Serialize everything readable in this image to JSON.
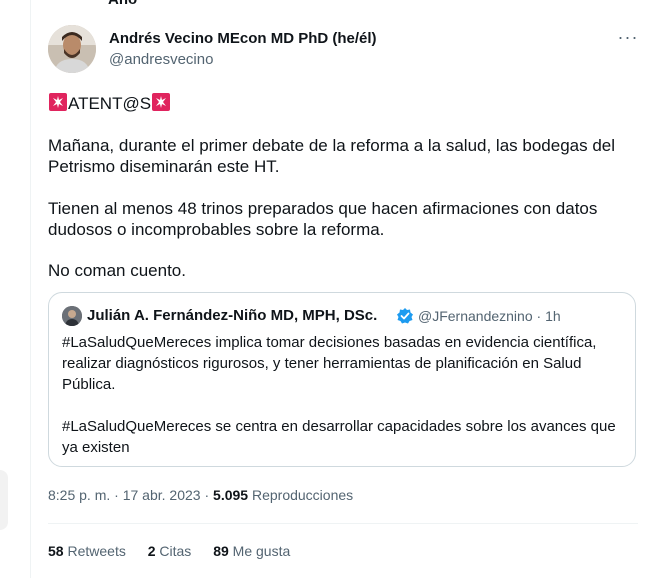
{
  "header": {
    "partial_top_text": "Ano"
  },
  "tweet": {
    "author_name": "Andrés Vecino MEcon MD PhD (he/él)",
    "author_handle": "@andresvecino",
    "more_label": "···",
    "alert_text": "ATENT@S",
    "paragraph_1": "Mañana, durante el primer debate de la reforma a la salud, las bodegas del Petrismo diseminarán este HT.",
    "paragraph_2": "Tienen al menos 48 trinos preparados que hacen afirmaciones con datos dudosos o incomprobables sobre la reforma.",
    "paragraph_3": "No coman cuento."
  },
  "quote": {
    "author_name": "Julián A. Fernández-Niño MD, MPH, DSc.",
    "author_handle": "@JFernandeznino",
    "separator": "·",
    "time_ago": "1h",
    "paragraph_1": "#LaSaludQueMereces implica tomar decisiones basadas en evidencia científica, realizar diagnósticos rigurosos, y tener herramientas de planificación en Salud Pública.",
    "paragraph_2": "#LaSaludQueMereces se centra en desarrollar capacidades sobre los avances que ya existen"
  },
  "meta": {
    "time": "8:25 p. m.",
    "separator": "·",
    "date": "17 abr. 2023",
    "views_count": "5.095",
    "views_label": "Reproducciones"
  },
  "stats": {
    "retweets_count": "58",
    "retweets_label": "Retweets",
    "quotes_count": "2",
    "quotes_label": "Citas",
    "likes_count": "89",
    "likes_label": "Me gusta"
  },
  "colors": {
    "text_primary": "#0f1419",
    "text_secondary": "#536471",
    "border": "#cfd9de",
    "verified_blue": "#1d9bf0",
    "siren_red": "#e0245e"
  },
  "icons": {
    "siren": "rotating-light-icon",
    "verified": "verified-badge-icon",
    "more": "more-horizontal-icon"
  }
}
